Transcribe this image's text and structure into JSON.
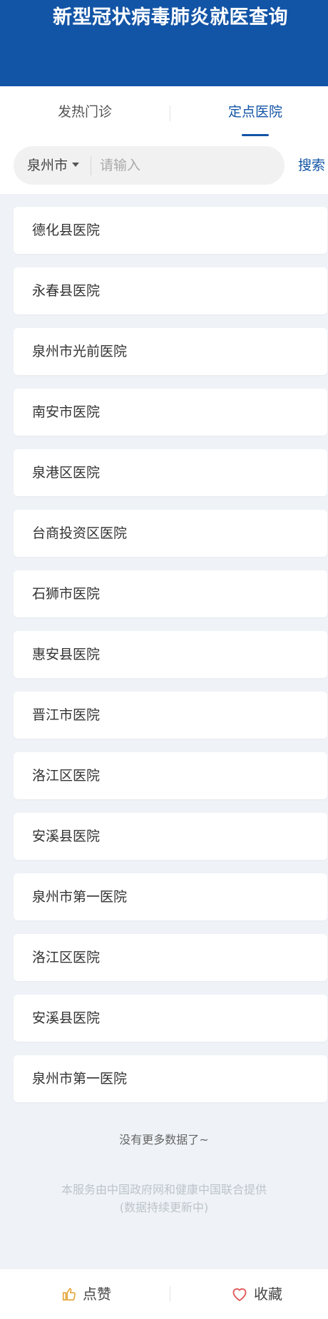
{
  "header": {
    "title": "新型冠状病毒肺炎就医查询"
  },
  "tabs": [
    {
      "label": "发热门诊",
      "active": false
    },
    {
      "label": "定点医院",
      "active": true
    }
  ],
  "search": {
    "city": "泉州市",
    "placeholder": "请输入",
    "value": "",
    "button_label": "搜索"
  },
  "hospitals": [
    "德化县医院",
    "永春县医院",
    "泉州市光前医院",
    "南安市医院",
    "泉港区医院",
    "台商投资区医院",
    "石狮市医院",
    "惠安县医院",
    "晋江市医院",
    "洛江区医院",
    "安溪县医院",
    "泉州市第一医院",
    "洛江区医院",
    "安溪县医院",
    "泉州市第一医院"
  ],
  "list_end_text": "没有更多数据了~",
  "footer": {
    "line1": "本服务由中国政府网和健康中国联合提供",
    "line2": "(数据持续更新中)"
  },
  "bottom_bar": {
    "like_label": "点赞",
    "favorite_label": "收藏"
  },
  "colors": {
    "primary": "#1254a6",
    "background": "#eff3f7",
    "like_icon": "#e5a43a",
    "favorite_icon": "#e25b5b"
  },
  "icons": {
    "like": "thumbs-up-icon",
    "favorite": "heart-icon",
    "dropdown": "caret-down-icon"
  }
}
